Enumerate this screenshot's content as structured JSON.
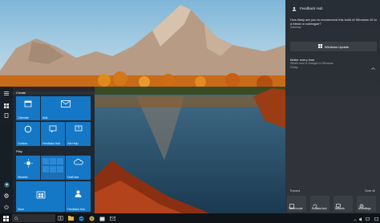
{
  "colors": {
    "tile_blue": "#1478c6",
    "start_bg": "#1c242c",
    "action_center_bg": "#1e2228",
    "taskbar_bg": "#101418"
  },
  "start_menu": {
    "group_create": "Create",
    "group_play": "Play",
    "tiles": {
      "calendar": "Calendar",
      "mail": "Mail",
      "cortana": "Cortana",
      "feedback": "Feedback Hub",
      "get_help": "Get Help",
      "weather": "Weather",
      "onedrive": "OneDrive",
      "store": "Store",
      "feedback_hub": "Feedback Hub"
    }
  },
  "action_center": {
    "header_app": "Feedback Hub",
    "notification_1": {
      "title": "How likely are you to recommend this build of Windows 10 to a friend or colleague?",
      "time": "Saturday"
    },
    "windows_update_button": "Windows Update",
    "notification_2": {
      "title": "Better every time",
      "body": "What's new or changed in Windows",
      "time": "Friday"
    },
    "expand_label": "Expand",
    "clear_all_label": "Clear all",
    "quick_actions": [
      {
        "label": "Tablet mode",
        "icon": "tablet-icon"
      },
      {
        "label": "Rotation lock",
        "icon": "rotation-lock-icon"
      },
      {
        "label": "Network",
        "icon": "network-icon"
      },
      {
        "label": "All settings",
        "icon": "settings-icon"
      }
    ]
  },
  "taskbar": {
    "clock_time": "",
    "icons": [
      "task-view-icon",
      "file-explorer-icon",
      "edge-icon",
      "chrome-icon",
      "store-icon",
      "mail-icon"
    ]
  }
}
